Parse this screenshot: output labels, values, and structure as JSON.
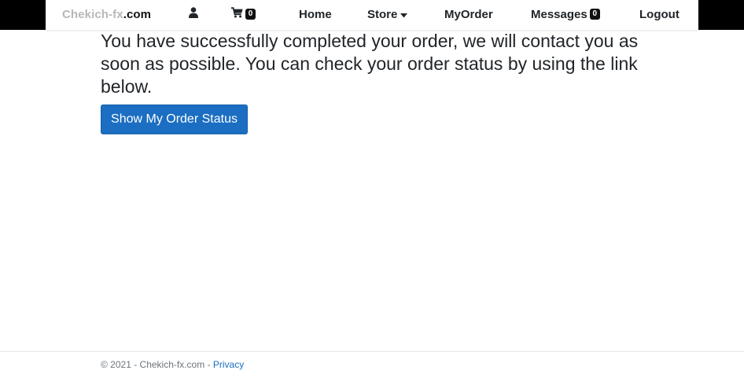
{
  "nav": {
    "brand_part1": "Chekich-fx",
    "brand_part2": ".com",
    "user_icon": "user-icon",
    "cart_icon": "shopping-cart-icon",
    "cart_count": "0",
    "home_label": "Home",
    "store_label": "Store",
    "store_caret_icon": "caret-down-icon",
    "myorder_label": "MyOrder",
    "messages_label": "Messages",
    "messages_count": "0",
    "logout_label": "Logout"
  },
  "main": {
    "message": "You have successfully completed your order, we will contact you as soon as possible. You can check your order status by using the link below.",
    "status_button_label": "Show My Order Status"
  },
  "footer": {
    "copyright": "© 2021 - Chekich-fx.com - ",
    "privacy_label": "Privacy"
  },
  "colors": {
    "primary_button": "#1b6ec2",
    "topbar": "#000000",
    "privacy_link": "#1b6ec2"
  }
}
